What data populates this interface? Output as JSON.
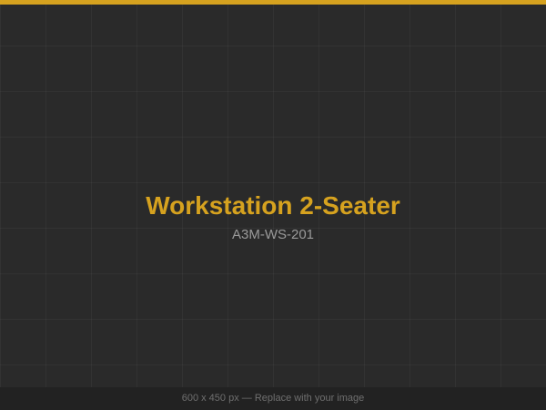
{
  "product": {
    "title": "Workstation 2-Seater",
    "code": "A3M-WS-201"
  },
  "footer": {
    "text": "600 x 450 px — Replace with your image"
  },
  "colors": {
    "accent": "#d6a21f",
    "background": "#2a2a2a",
    "footer_bg": "#222222",
    "subtitle": "#9a9a9a",
    "footer_text": "#6f6f6f"
  }
}
